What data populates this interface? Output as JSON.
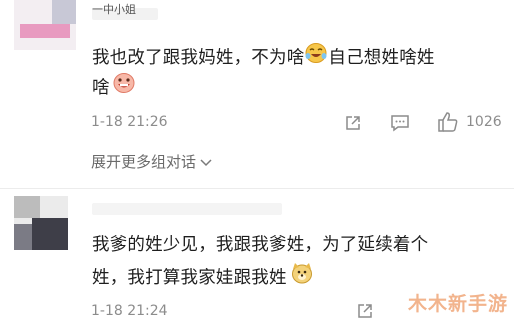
{
  "comment1": {
    "username": "一中小姐",
    "text_line1": "我也改了跟我妈姓，不为啥",
    "text_line1_after_emoji": "自己想姓啥姓",
    "text_line2": "啥",
    "emoji1": "laugh-emoji",
    "emoji2": "grin-emoji",
    "timestamp": "1-18 21:26",
    "like_count": "1026",
    "expand_label": "展开更多组对话"
  },
  "comment2": {
    "text_line1": "我爹的姓少见，我跟我爹姓，为了延续着个",
    "text_line2": "姓，我打算我家娃跟我姓",
    "emoji": "doge-emoji",
    "timestamp": "1-18 21:24"
  },
  "watermark": "木木新手游",
  "colors": {
    "text": "#1e1e1e",
    "meta": "#8c8c8c",
    "watermark": "#f0a77a"
  }
}
